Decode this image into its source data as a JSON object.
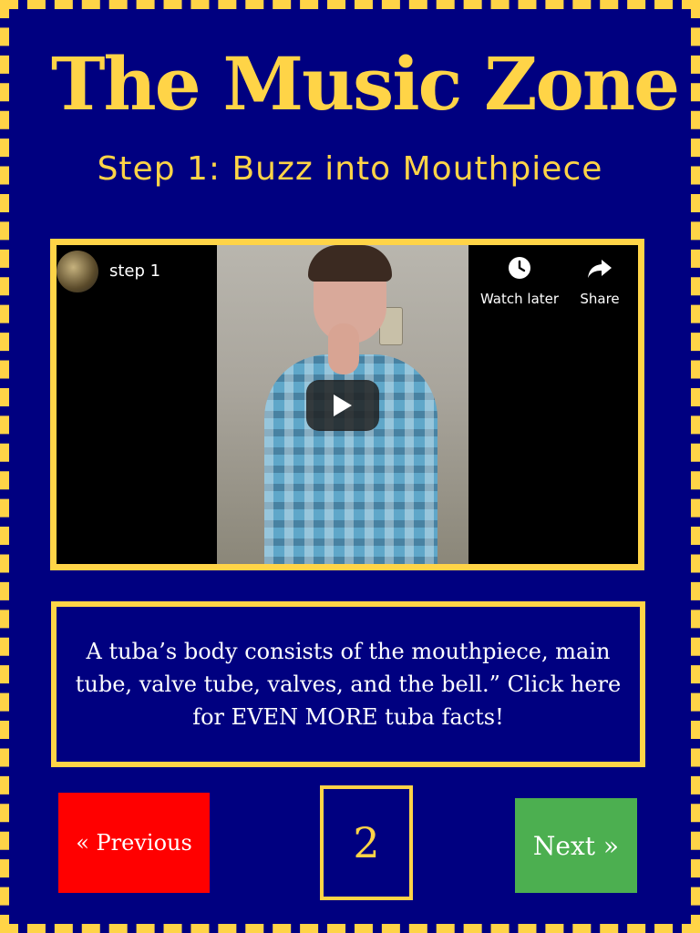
{
  "site": {
    "title": "The Music Zone"
  },
  "step": {
    "heading": "Step 1: Buzz into Mouthpiece"
  },
  "video": {
    "title": "step 1",
    "actions": [
      {
        "label": "Watch later",
        "icon": "clock-icon"
      },
      {
        "label": "Share",
        "icon": "share-arrow-icon"
      }
    ],
    "play_icon": "play-icon"
  },
  "fact": {
    "text": "A tuba’s body consists of the mouthpiece, main tube, valve tube, valves, and the bell.” Click here for EVEN MORE tuba facts!"
  },
  "pagination": {
    "previous_label": "« Previous",
    "page_number": "2",
    "next_label": "Next »"
  },
  "colors": {
    "background": "#000080",
    "accent": "#FFD447",
    "previous_button": "#FF0000",
    "next_button": "#4CAF50"
  }
}
